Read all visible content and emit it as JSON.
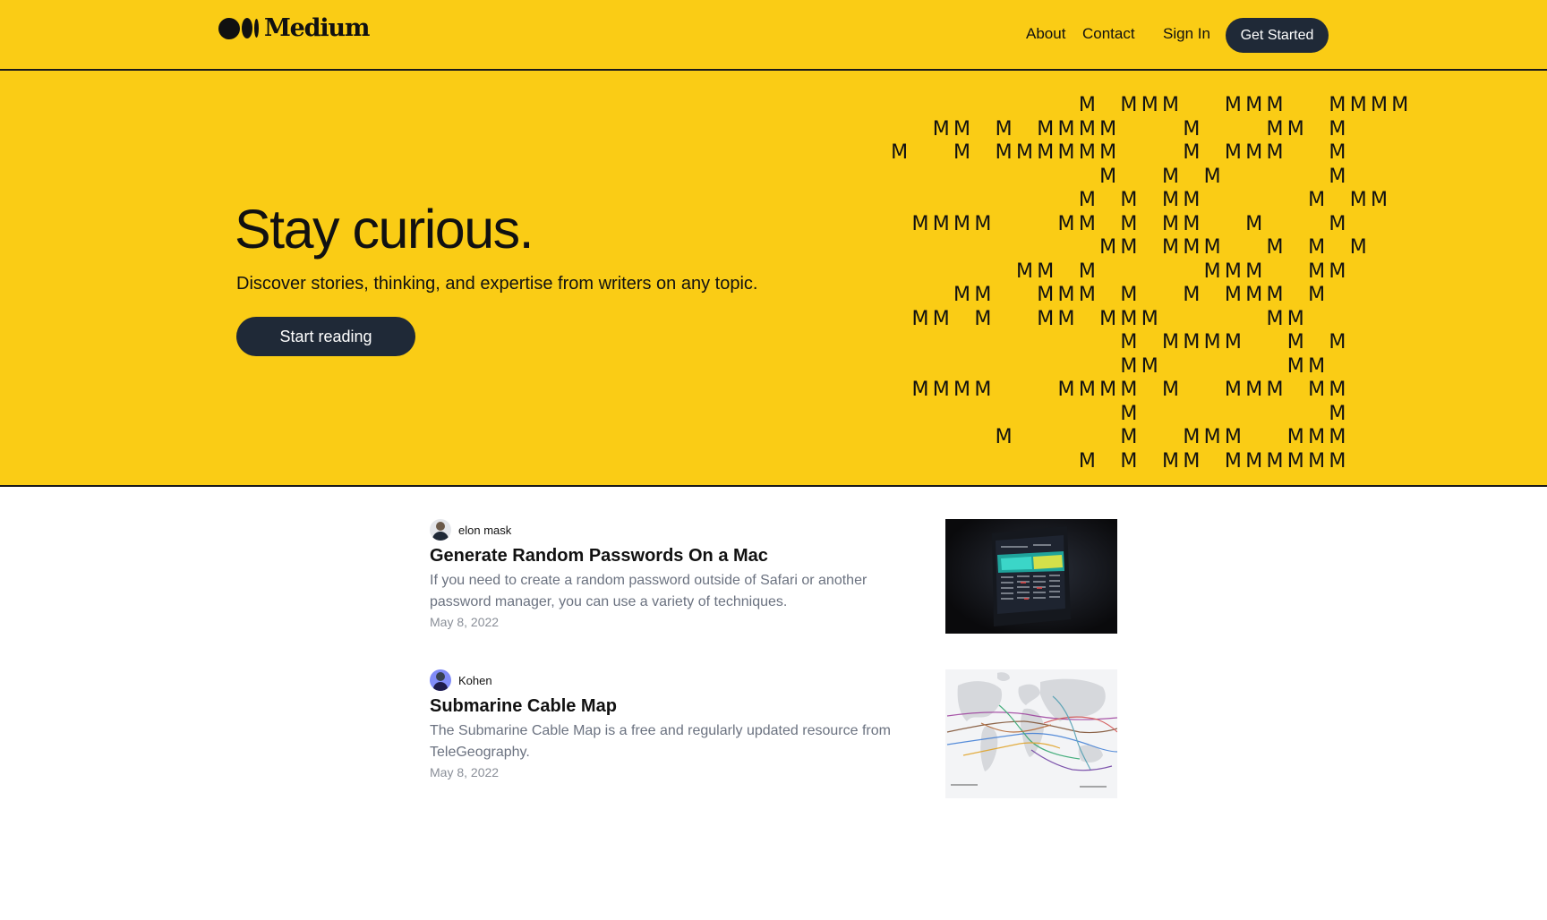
{
  "header": {
    "logo_text": "Medium",
    "nav": {
      "about": "About",
      "contact": "Contact",
      "sign_in": "Sign In",
      "get_started": "Get Started"
    }
  },
  "hero": {
    "title": "Stay curious.",
    "subtitle": "Discover stories, thinking, and expertise from writers on any topic.",
    "cta": "Start reading",
    "pattern_rows": [
      "         M MMM  MMM  MMMM",
      "  MM M MMMM   M   MM M",
      "M  M MMMMMM   M MMM  M",
      "          M  M M     M",
      "         M M MM     M MM",
      " MMMM   MM M MM  M   M",
      "          MM MMM  M M M",
      "      MM M     MMM  MM",
      "   MM  MMM M  M MMM M",
      " MM M  MM MMM     MM",
      "           M MMMM  M M",
      "           MM      MM",
      " MMMM   MMMM M  MMM MM",
      "           M         M",
      "     M     M  MMM  MMM",
      "         M M MM MMMMMM"
    ]
  },
  "articles": [
    {
      "author": "elon mask",
      "title": "Generate Random Passwords On a Mac",
      "description": "If you need to create a random password outside of Safari or another password manager, you can use a variety of techniques.",
      "date": "May 8, 2022"
    },
    {
      "author": "Kohen",
      "title": "Submarine Cable Map",
      "description": "The Submarine Cable Map is a free and regularly updated resource from TeleGeography.",
      "date": "May 8, 2022"
    }
  ],
  "colors": {
    "brand_yellow": "#facc15",
    "dark_button": "#1f2937",
    "muted_text": "#6b7280"
  },
  "icons": [
    "medium-logo-icon",
    "avatar"
  ]
}
